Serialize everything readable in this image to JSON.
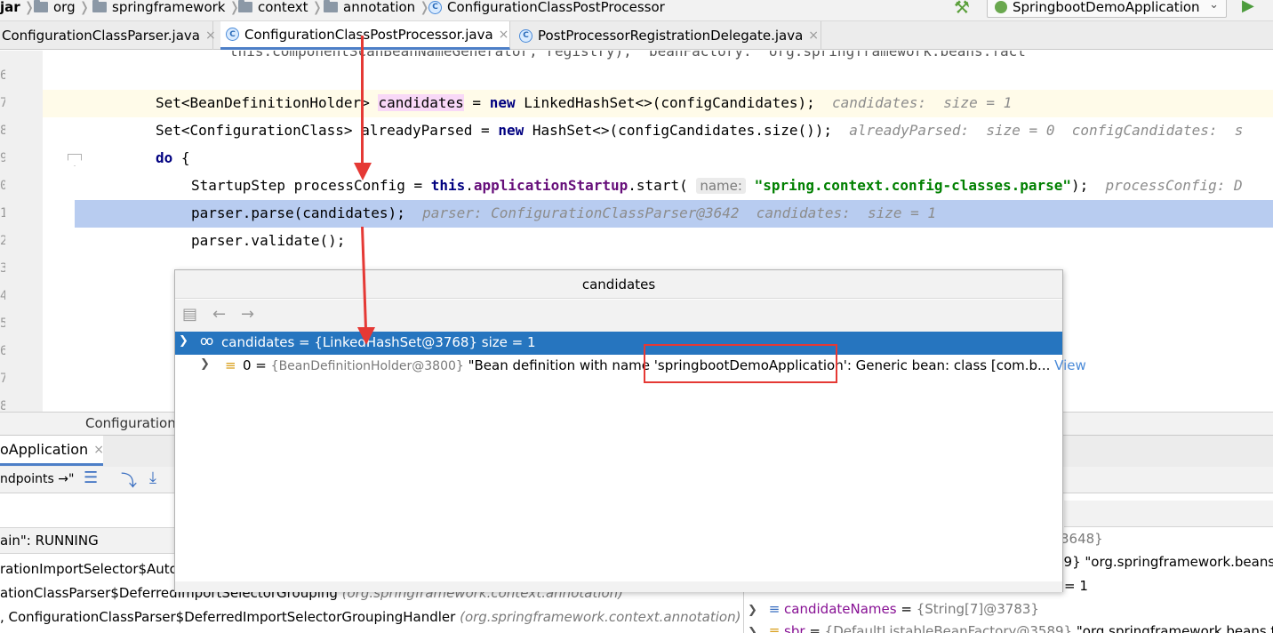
{
  "breadcrumb": {
    "items": [
      {
        "label": "jar",
        "icon": "none"
      },
      {
        "label": "org",
        "icon": "folder-icon"
      },
      {
        "label": "springframework",
        "icon": "folder-icon"
      },
      {
        "label": "context",
        "icon": "folder-icon"
      },
      {
        "label": "annotation",
        "icon": "folder-icon"
      },
      {
        "label": "ConfigurationClassPostProcessor",
        "icon": "class-icon"
      }
    ],
    "separator": "❭"
  },
  "run_config": {
    "label": "SpringbootDemoApplication"
  },
  "tabs": [
    {
      "label": "ConfigurationClassParser.java",
      "active": false
    },
    {
      "label": "ConfigurationClassPostProcessor.java",
      "active": true
    },
    {
      "label": "PostProcessorRegistrationDelegate.java",
      "active": false
    }
  ],
  "tab_close": "×",
  "class_icon_letter": "C",
  "line_numbers": [
    "6",
    "7",
    "8",
    "9",
    "0",
    "1",
    "2",
    "3",
    "4",
    "5",
    "6",
    "7",
    "8"
  ],
  "code": {
    "line_top": "this.componentScanBeanNameGenerator, registry);  beanFactory: \"org.springframework.beans.fact",
    "line_candidates": {
      "type": "Set<BeanDefinitionHolder> ",
      "var": "candidates",
      "rest1": " = ",
      "kw": "new",
      "rest2": " LinkedHashSet<>(configCandidates);",
      "inlay": "candidates:  size = 1"
    },
    "line_parsed": {
      "pre": "Set<ConfigurationClass> alreadyParsed = ",
      "kw": "new",
      "rest": " HashSet<>(configCandidates.size());",
      "inlay": "alreadyParsed:  size = 0  configCandidates:  s"
    },
    "line_do": {
      "kw": "do",
      "rest": " {"
    },
    "line_step": {
      "pre": "StartupStep processConfig = ",
      "kw": "this",
      "dot": ".",
      "field": "applicationStartup",
      "mid": ".start(",
      "hint": "name:",
      "str": "\"spring.context.config-classes.parse\"",
      "end": ");",
      "inlay": "processConfig: D"
    },
    "line_parse": {
      "code": "parser.parse(candidates);",
      "inlay": "parser: ConfigurationClassParser@3642  candidates:  size = 1"
    },
    "line_validate": "parser.validate();"
  },
  "editor_status": "Configuration",
  "debug": {
    "tab_label": "oApplication",
    "endpoints_label": "ndpoints",
    "endpoints_suffix": "→\"",
    "thread_status": "ain\": RUNNING",
    "frames": [
      {
        "text": "rationImportSelector$Auto",
        "pkg": ""
      },
      {
        "text": "ationClassParser$DeferredImportSelectorGrouping ",
        "pkg": "(org.springframework.context.annotation)"
      },
      {
        "text": ", ConfigurationClassParser$DeferredImportSelectorGroupingHandler ",
        "pkg": "(org.springframework.context.annotation)"
      }
    ],
    "vars": [
      {
        "text": "3648}"
      },
      {
        "text": "89} \"org.springframework.beans"
      },
      {
        "text": "= 1"
      }
    ],
    "var_candidate_names": {
      "name": "candidateNames",
      "eq": " = ",
      "obj": "{String[7]@3783}"
    },
    "var_sbr": {
      "name": "sbr",
      "eq": " = ",
      "obj": "{DefaultListableBeanFactory@3589}",
      "val": " \"org.springframework.beans.facto"
    }
  },
  "popup": {
    "title": "candidates",
    "root_row": "candidates = {LinkedHashSet@3768}  size = 1",
    "child_row": {
      "pre": "0 = ",
      "obj": "{BeanDefinitionHolder@3800}",
      "text1": " \"Bean definition with name '",
      "highlight": "springbootDemoApplication",
      "text2": "': Generic bean: class [com.b...",
      "link": "View"
    }
  },
  "colors": {
    "accent": "#2675bf",
    "annotation_red": "#e53935",
    "keyword": "#000080",
    "string": "#008000"
  }
}
